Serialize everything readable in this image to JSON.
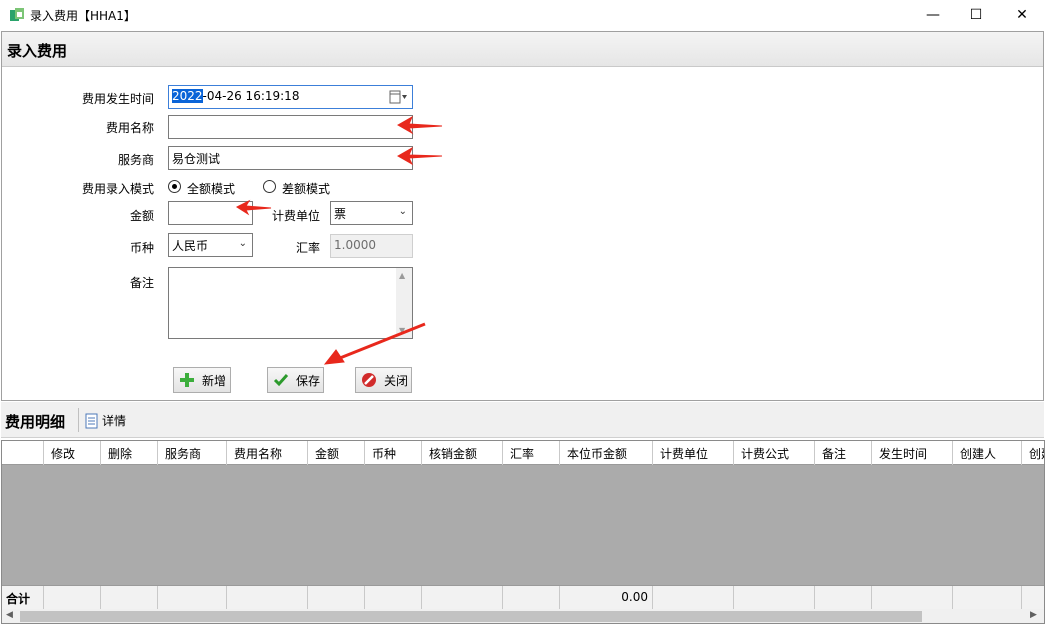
{
  "window": {
    "title": "录入费用【HHA1】",
    "minimize": "—",
    "maximize": "☐",
    "close": "✕"
  },
  "form": {
    "section_title": "录入费用",
    "occur_time": {
      "label": "费用发生时间",
      "value_selected": "2022",
      "value_rest": "-04-26 16:19:18"
    },
    "fee_name": {
      "label": "费用名称",
      "value": ""
    },
    "provider": {
      "label": "服务商",
      "value": "易仓测试"
    },
    "entry_mode": {
      "label": "费用录入模式",
      "options": [
        "全额模式",
        "差额模式"
      ],
      "selected": "全额模式"
    },
    "amount": {
      "label": "金额",
      "value": ""
    },
    "unit": {
      "label": "计费单位",
      "value": "票"
    },
    "currency": {
      "label": "币种",
      "value": "人民币"
    },
    "rate": {
      "label": "汇率",
      "value": "1.0000"
    },
    "remark": {
      "label": "备注",
      "value": ""
    },
    "buttons": {
      "add": "新增",
      "save": "保存",
      "close": "关闭"
    }
  },
  "detail": {
    "title": "费用明细",
    "detail_button": "详情",
    "columns": [
      "修改",
      "删除",
      "服务商",
      "费用名称",
      "金额",
      "币种",
      "核销金额",
      "汇率",
      "本位币金额",
      "计费单位",
      "计费公式",
      "备注",
      "发生时间",
      "创建人",
      "创建"
    ],
    "footer": {
      "label": "合计",
      "local_amount_total": "0.00"
    }
  },
  "icons": {
    "app": "app-logo-icon",
    "calendar": "calendar-icon",
    "add": "plus-icon",
    "save": "checkmark-icon",
    "close": "no-entry-icon",
    "detail": "document-icon"
  },
  "colors": {
    "selection": "#0a64d8",
    "annotation_arrow": "#e8281c",
    "grid_body": "#ababab"
  }
}
